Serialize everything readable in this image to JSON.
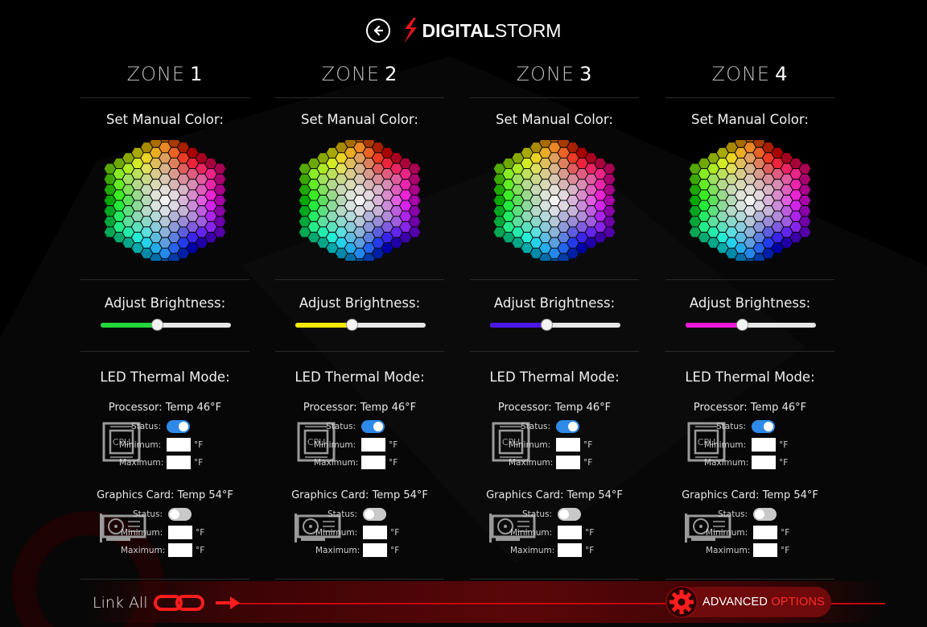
{
  "header": {
    "back_icon": "back-arrow-circle-icon",
    "logo_bold": "DIGITAL",
    "logo_light": "STORM"
  },
  "zones": [
    {
      "title_word": "ZONE",
      "title_num": "1",
      "color_label": "Set Manual Color:",
      "brightness_label": "Adjust Brightness:",
      "brightness_color": "#22d63c",
      "brightness_value": 0.43,
      "thermal_label": "LED Thermal Mode:",
      "cpu": {
        "title": "Processor: Temp 46°F",
        "status_label": "Status:",
        "status_on": true,
        "min_label": "Minimum:",
        "max_label": "Maximum:",
        "min_value": "",
        "max_value": "",
        "unit": "°F",
        "icon": "cpu-chip-icon"
      },
      "gpu": {
        "title": "Graphics Card: Temp 54°F",
        "status_label": "Status:",
        "status_on": false,
        "min_label": "Minimum:",
        "max_label": "Maximum:",
        "min_value": "",
        "max_value": "",
        "unit": "°F",
        "icon": "graphics-card-icon"
      }
    },
    {
      "title_word": "ZONE",
      "title_num": "2",
      "color_label": "Set Manual Color:",
      "brightness_label": "Adjust Brightness:",
      "brightness_color": "#f4e606",
      "brightness_value": 0.43,
      "thermal_label": "LED Thermal Mode:",
      "cpu": {
        "title": "Processor: Temp 46°F",
        "status_label": "Status:",
        "status_on": true,
        "min_label": "Minimum:",
        "max_label": "Maximum:",
        "min_value": "",
        "max_value": "",
        "unit": "°F",
        "icon": "cpu-chip-icon"
      },
      "gpu": {
        "title": "Graphics Card: Temp 54°F",
        "status_label": "Status:",
        "status_on": false,
        "min_label": "Minimum:",
        "max_label": "Maximum:",
        "min_value": "",
        "max_value": "",
        "unit": "°F",
        "icon": "graphics-card-icon"
      }
    },
    {
      "title_word": "ZONE",
      "title_num": "3",
      "color_label": "Set Manual Color:",
      "brightness_label": "Adjust Brightness:",
      "brightness_color": "#4a18e8",
      "brightness_value": 0.43,
      "thermal_label": "LED Thermal Mode:",
      "cpu": {
        "title": "Processor: Temp 46°F",
        "status_label": "Status:",
        "status_on": true,
        "min_label": "Minimum:",
        "max_label": "Maximum:",
        "min_value": "",
        "max_value": "",
        "unit": "°F",
        "icon": "cpu-chip-icon"
      },
      "gpu": {
        "title": "Graphics Card: Temp 54°F",
        "status_label": "Status:",
        "status_on": false,
        "min_label": "Minimum:",
        "max_label": "Maximum:",
        "min_value": "",
        "max_value": "",
        "unit": "°F",
        "icon": "graphics-card-icon"
      }
    },
    {
      "title_word": "ZONE",
      "title_num": "4",
      "color_label": "Set Manual Color:",
      "brightness_label": "Adjust Brightness:",
      "brightness_color": "#f018d8",
      "brightness_value": 0.43,
      "thermal_label": "LED Thermal Mode:",
      "cpu": {
        "title": "Processor: Temp 46°F",
        "status_label": "Status:",
        "status_on": true,
        "min_label": "Minimum:",
        "max_label": "Maximum:",
        "min_value": "",
        "max_value": "",
        "unit": "°F",
        "icon": "cpu-chip-icon"
      },
      "gpu": {
        "title": "Graphics Card: Temp 54°F",
        "status_label": "Status:",
        "status_on": false,
        "min_label": "Minimum:",
        "max_label": "Maximum:",
        "min_value": "",
        "max_value": "",
        "unit": "°F",
        "icon": "graphics-card-icon"
      }
    }
  ],
  "footer": {
    "link_all_label": "Link All",
    "link_icon": "chain-link-icon",
    "arrow_icon": "arrow-right-icon",
    "advanced_word1": "ADVANCED",
    "advanced_word2": "OPTIONS",
    "gear_icon": "gear-icon"
  },
  "colors": {
    "accent_red": "#c5080c",
    "toggle_on": "#2d8ae8",
    "toggle_off": "#c9c9c9"
  }
}
